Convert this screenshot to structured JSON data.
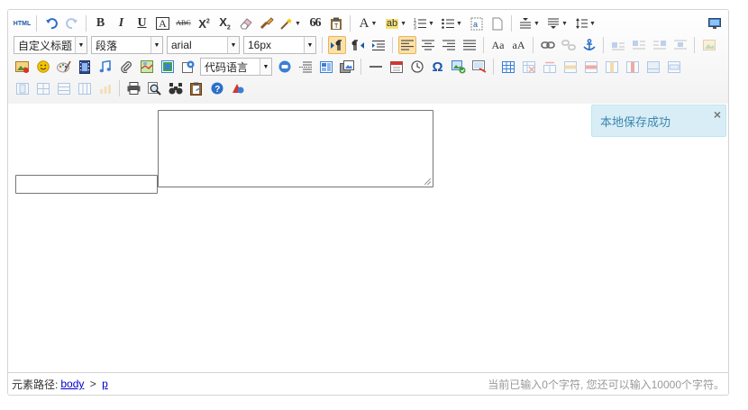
{
  "toolbar": {
    "html_label": "HTML",
    "bold": "B",
    "italic": "I",
    "underline": "U",
    "fontborder": "A",
    "strikethrough": "ABC",
    "superscript_base": "X",
    "superscript_mark": "2",
    "subscript_base": "X",
    "subscript_mark": "2",
    "blockquote": "66",
    "forecolor": "A",
    "backcolor": "ab",
    "paragraph_select": "自定义标题",
    "heading_select": "段落",
    "font_select": "arial",
    "size_select": "16px",
    "code_select": "代码语言",
    "touppercase": "Aa",
    "tolowercase": "aA",
    "omega": "Ω"
  },
  "toast": {
    "message": "本地保存成功",
    "close": "×"
  },
  "status": {
    "path_label": "元素路径:",
    "path_body": "body",
    "path_sep": ">",
    "path_p": "p",
    "word_count": "当前已输入0个字符, 您还可以输入10000个字符。"
  },
  "colors": {
    "toast_bg": "#d9edf7",
    "toast_text": "#3a87ad",
    "active_bg": "#fce2a8",
    "link": "#0000cc"
  }
}
